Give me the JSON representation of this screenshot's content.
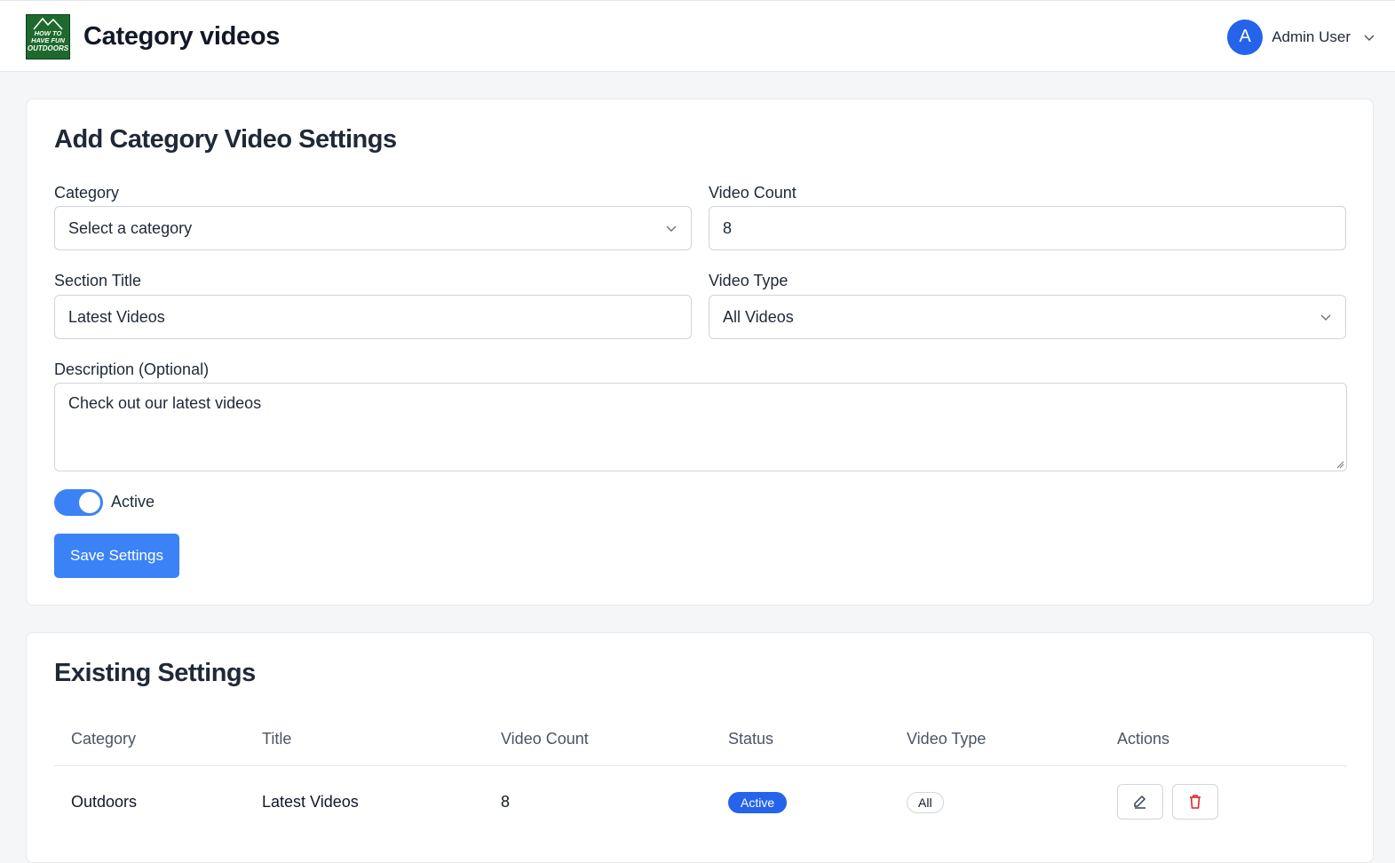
{
  "header": {
    "logo_text": "HOW TO HAVE FUN OUTDOORS",
    "title": "Category videos",
    "user": {
      "initial": "A",
      "name": "Admin User"
    }
  },
  "form": {
    "title": "Add Category Video Settings",
    "category_label": "Category",
    "category_value": "Select a category",
    "video_count_label": "Video Count",
    "video_count_value": "8",
    "section_title_label": "Section Title",
    "section_title_value": "Latest Videos",
    "video_type_label": "Video Type",
    "video_type_value": "All Videos",
    "description_label": "Description (Optional)",
    "description_value": "Check out our latest videos",
    "active_label": "Active",
    "active": true,
    "save_label": "Save Settings"
  },
  "existing": {
    "title": "Existing Settings",
    "columns": [
      "Category",
      "Title",
      "Video Count",
      "Status",
      "Video Type",
      "Actions"
    ],
    "rows": [
      {
        "category": "Outdoors",
        "title": "Latest Videos",
        "video_count": "8",
        "status": "Active",
        "video_type": "All"
      }
    ]
  },
  "colors": {
    "primary": "#3b82f6",
    "avatar": "#2563eb",
    "logo_bg": "#1e6a2e",
    "delete": "#dc2626"
  }
}
